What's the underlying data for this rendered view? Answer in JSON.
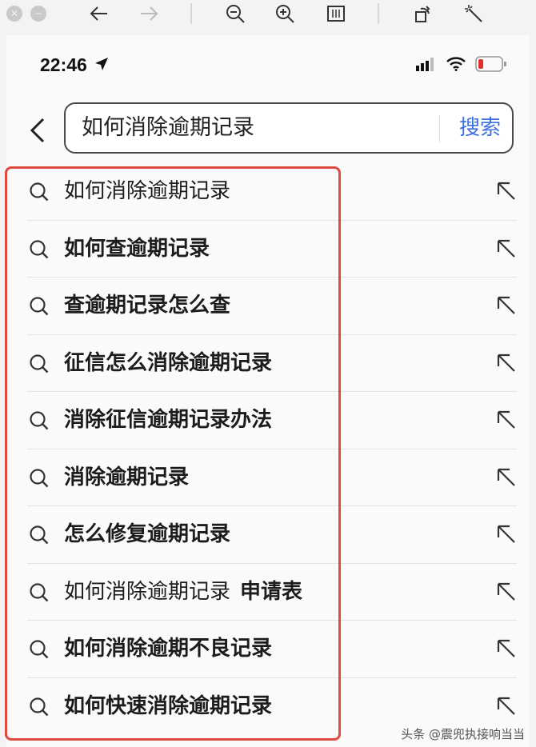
{
  "status": {
    "time": "22:46"
  },
  "search": {
    "query": "如何消除逾期记录",
    "button": "搜索"
  },
  "suggestions": [
    {
      "text": "如何消除逾期记录",
      "suffix": "",
      "bold": false
    },
    {
      "text": "如何查逾期记录",
      "suffix": "",
      "bold": true
    },
    {
      "text": "查逾期记录怎么查",
      "suffix": "",
      "bold": true
    },
    {
      "text": "征信怎么消除逾期记录",
      "suffix": "",
      "bold": true
    },
    {
      "text": "消除征信逾期记录办法",
      "suffix": "",
      "bold": true
    },
    {
      "text": "消除逾期记录",
      "suffix": "",
      "bold": true
    },
    {
      "text": "怎么修复逾期记录",
      "suffix": "",
      "bold": true
    },
    {
      "text": "如何消除逾期记录",
      "suffix": "申请表",
      "bold": false
    },
    {
      "text": "如何消除逾期不良记录",
      "suffix": "",
      "bold": true
    },
    {
      "text": "如何快速消除逾期记录",
      "suffix": "",
      "bold": true
    }
  ],
  "watermark": "头条 @震兜执接响当当",
  "colors": {
    "accent": "#3c6fe0",
    "highlight": "#e04a3f",
    "battery_low": "#e03030"
  }
}
